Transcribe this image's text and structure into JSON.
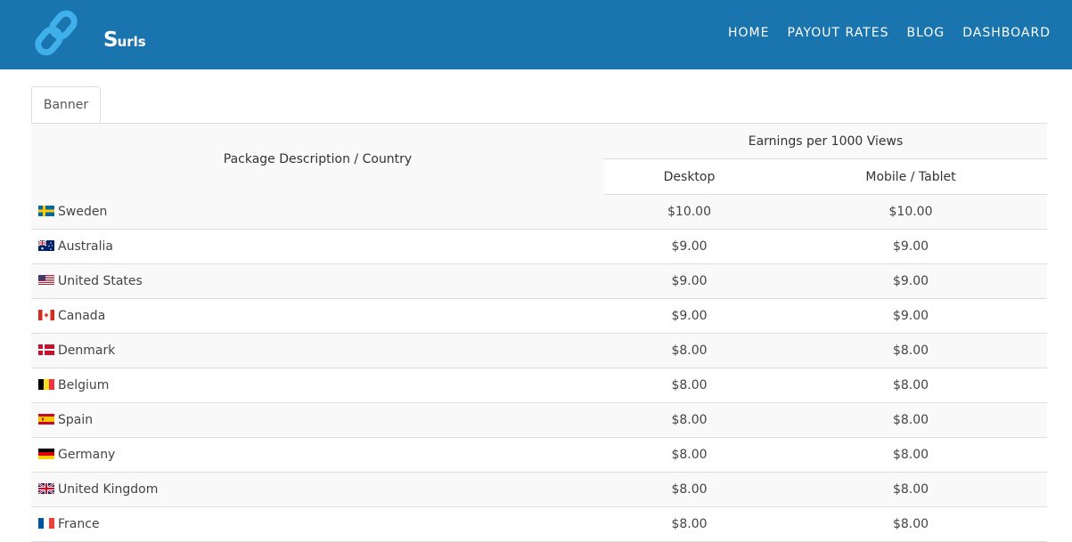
{
  "brand": {
    "logo_big": "S",
    "logo_small": "urls"
  },
  "nav": {
    "items": [
      "HOME",
      "PAYOUT RATES",
      "BLOG",
      "DASHBOARD"
    ]
  },
  "tabs": {
    "banner_label": "Banner"
  },
  "table": {
    "header_country": "Package Description / Country",
    "header_earnings": "Earnings per 1000 Views",
    "header_desktop": "Desktop",
    "header_mobile": "Mobile / Tablet",
    "rows": [
      {
        "flag": "se-flag-icon",
        "country": "Sweden",
        "desktop": "$10.00",
        "mobile": "$10.00"
      },
      {
        "flag": "au-flag-icon",
        "country": "Australia",
        "desktop": "$9.00",
        "mobile": "$9.00"
      },
      {
        "flag": "us-flag-icon",
        "country": "United States",
        "desktop": "$9.00",
        "mobile": "$9.00"
      },
      {
        "flag": "ca-flag-icon",
        "country": "Canada",
        "desktop": "$9.00",
        "mobile": "$9.00"
      },
      {
        "flag": "dk-flag-icon",
        "country": "Denmark",
        "desktop": "$8.00",
        "mobile": "$8.00"
      },
      {
        "flag": "be-flag-icon",
        "country": "Belgium",
        "desktop": "$8.00",
        "mobile": "$8.00"
      },
      {
        "flag": "es-flag-icon",
        "country": "Spain",
        "desktop": "$8.00",
        "mobile": "$8.00"
      },
      {
        "flag": "de-flag-icon",
        "country": "Germany",
        "desktop": "$8.00",
        "mobile": "$8.00"
      },
      {
        "flag": "gb-flag-icon",
        "country": "United Kingdom",
        "desktop": "$8.00",
        "mobile": "$8.00"
      },
      {
        "flag": "fr-flag-icon",
        "country": "France",
        "desktop": "$8.00",
        "mobile": "$8.00"
      }
    ]
  },
  "colors": {
    "navbar": "#1a74ad",
    "logo_link": "#3fb0ea",
    "stripe": "#f9f9f9",
    "border": "#dddddd"
  }
}
